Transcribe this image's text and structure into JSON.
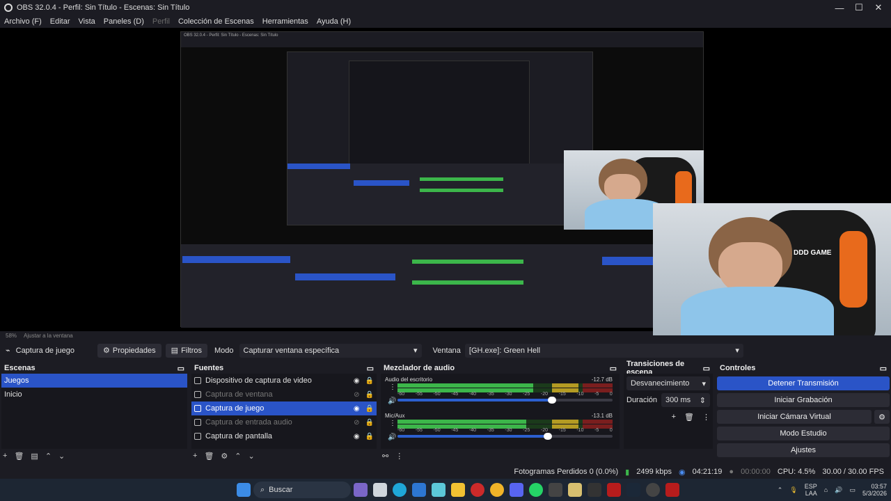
{
  "window": {
    "title": "OBS 32.0.4 - Perfil: Sin Título - Escenas: Sin Título"
  },
  "menu": {
    "items": [
      "Archivo (F)",
      "Editar",
      "Vista",
      "Paneles (D)",
      "Perfil",
      "Colección de Escenas",
      "Herramientas",
      "Ayuda (H)"
    ]
  },
  "preview": {
    "zoom": "58%",
    "fit": "Ajustar a la ventana",
    "nested_title": "OBS 32.0.4 - Perfil: Sin Título - Escenas: Sin Título",
    "cam_text": "DDD GAME"
  },
  "toolbar": {
    "source": "Captura de juego",
    "properties": "Propiedades",
    "filters": "Filtros",
    "mode_label": "Modo",
    "mode_value": "Capturar ventana específica",
    "window_label": "Ventana",
    "window_value": "[GH.exe]: Green Hell"
  },
  "scenes": {
    "title": "Escenas",
    "items": [
      "Juegos",
      "Inicio"
    ]
  },
  "sources": {
    "title": "Fuentes",
    "items": [
      "Dispositivo de captura de video",
      "Captura de ventana",
      "Captura de juego",
      "Captura de entrada audio",
      "Captura de pantalla"
    ]
  },
  "mixer": {
    "title": "Mezclador de audio",
    "channels": [
      {
        "name": "Audio del escritorio",
        "db": "-12.7 dB",
        "level": 0.63,
        "volume": 0.72
      },
      {
        "name": "Mic/Aux",
        "db": "-13.1 dB",
        "level": 0.6,
        "volume": 0.7
      }
    ],
    "ticks": [
      "-60",
      "-55",
      "-50",
      "-45",
      "-40",
      "-35",
      "-30",
      "-25",
      "-20",
      "-15",
      "-10",
      "-5",
      "0"
    ]
  },
  "transitions": {
    "title": "Transiciones de escena",
    "type": "Desvanecimiento",
    "duration_label": "Duración",
    "duration_value": "300 ms"
  },
  "controls": {
    "title": "Controles",
    "buttons": [
      "Detener Transmisión",
      "Iniciar Grabación",
      "Iniciar Cámara Virtual",
      "Modo Estudio",
      "Ajustes"
    ]
  },
  "status": {
    "dropped": "Fotogramas Perdidos 0 (0.0%)",
    "bitrate": "2499 kbps",
    "stream_time": "04:21:19",
    "rec_time": "00:00:00",
    "cpu": "CPU: 4.5%",
    "fps": "30.00 / 30.00 FPS"
  },
  "taskbar": {
    "search": "Buscar",
    "lang1": "ESP",
    "lang2": "LAA",
    "time": "03:57",
    "date": "5/3/2026"
  },
  "colors": {
    "accent": "#2a54c7",
    "bg": "#1c1c23",
    "meter_green": "#3cb64a"
  }
}
